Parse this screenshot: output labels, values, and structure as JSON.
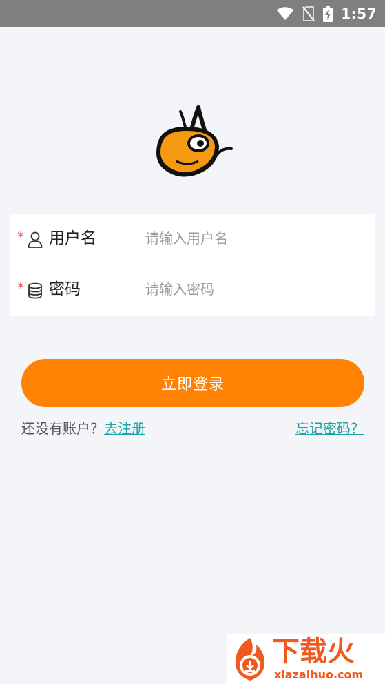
{
  "status_bar": {
    "time": "1:57",
    "icons": [
      "wifi-icon",
      "no-sim-icon",
      "battery-charging-icon"
    ]
  },
  "logo": {
    "icon": "bee-mascot-logo"
  },
  "form": {
    "username": {
      "required_mark": "*",
      "icon": "user-icon",
      "label": "用户名",
      "placeholder": "请输入用户名",
      "value": ""
    },
    "password": {
      "required_mark": "*",
      "icon": "database-icon",
      "label": "密码",
      "placeholder": "请输入密码",
      "value": ""
    }
  },
  "login_button": {
    "label": "立即登录"
  },
  "links": {
    "no_account_text": "还没有账户？",
    "register_label": "去注册",
    "forgot_label": "忘记密码？"
  },
  "watermark": {
    "text": "下载火",
    "domain": "xiazaihuo.com"
  },
  "colors": {
    "accent": "#ff8205",
    "link": "#1aa3a3",
    "required": "#f23b3b",
    "status_bar": "#7f7f7f",
    "background": "#f4f5f9"
  }
}
